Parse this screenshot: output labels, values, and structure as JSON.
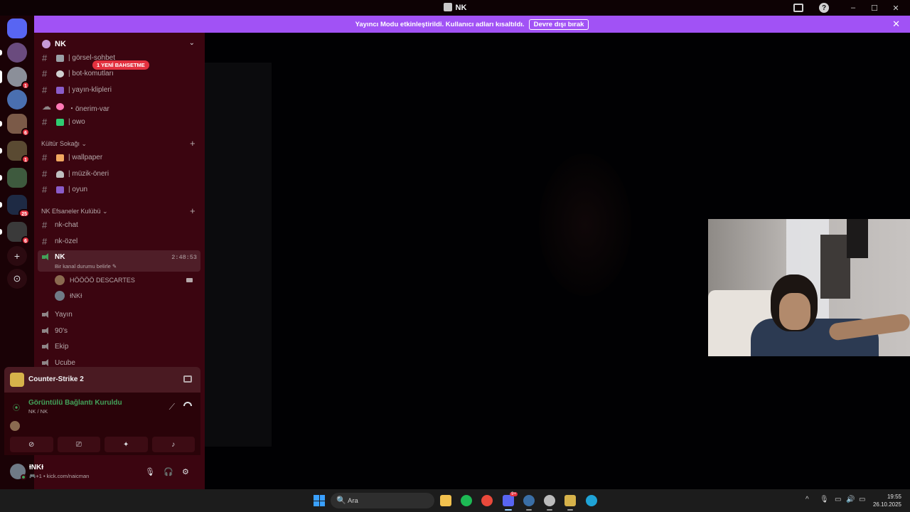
{
  "window": {
    "title": "NK",
    "minimize": "–",
    "maximize": "☐",
    "close": "✕",
    "help": "?"
  },
  "banner": {
    "message": "Yayıncı Modu etkinleştirildi. Kullanıcı adları kısaltıldı.",
    "button_label": "Devre dışı bırak",
    "close": "✕",
    "color": "#a152f5"
  },
  "guilds": [
    {
      "badge": ""
    },
    {
      "badge": ""
    },
    {
      "badge": "1"
    },
    {
      "badge": ""
    },
    {
      "badge": "6"
    },
    {
      "badge": "1"
    },
    {
      "badge": ""
    },
    {
      "badge": "25"
    },
    {
      "badge": "6"
    }
  ],
  "guild_actions": {
    "add": "+",
    "explore": "⊙"
  },
  "server": {
    "name": "NK",
    "chevron": "⌄"
  },
  "mention_pill": "1 YENİ BAHSETME",
  "channels_top": [
    {
      "label": "| görsel-sohbet",
      "emoji_color": "#9aa0a6"
    },
    {
      "label": "| bot-komutları",
      "emoji_color": "#d0d0d0"
    },
    {
      "label": "| yayın-klipleri",
      "emoji_color": "#8a5cc9"
    },
    {
      "label": "・önerim-var",
      "emoji_color": "#ff78b5"
    },
    {
      "label": "| owo",
      "emoji_color": "#2ecc71"
    }
  ],
  "category_kultur": {
    "label": "Kültür Sokağı ⌄",
    "plus": "+"
  },
  "channels_kultur": [
    {
      "label": "| wallpaper",
      "emoji_color": "#f0a860"
    },
    {
      "label": "| müzik-öneri",
      "emoji_color": "#c0c0c0"
    },
    {
      "label": "| oyun",
      "emoji_color": "#8a5cc9"
    }
  ],
  "category_nk": {
    "label": "NK Efsaneler Kulübü ⌄",
    "plus": "+"
  },
  "channels_nk": [
    {
      "label": "nk-chat"
    },
    {
      "label": "nk-özel"
    }
  ],
  "voice_active": {
    "label": "NK",
    "status": "Bir kanal durumu belirle ✎",
    "timer": "2:48:53"
  },
  "voice_users": [
    {
      "name": "HÖÖÖÖ DESCARTES"
    },
    {
      "name": "ƗNKƗ"
    }
  ],
  "voice_channels": [
    {
      "label": "Yayın"
    },
    {
      "label": "90's"
    },
    {
      "label": "Ekip"
    },
    {
      "label": "Ucube"
    }
  ],
  "game": {
    "name": "Counter-Strike 2"
  },
  "voice_panel": {
    "status": "Görüntülü Bağlantı Kuruldu",
    "channel": "NK / NK",
    "signal": "⦿",
    "noise": "⟋",
    "buttons": [
      "⊘",
      "⎚",
      "✦",
      "♪"
    ]
  },
  "user": {
    "name": "ƗNKƗ",
    "status": "🎮+1 • kick.com/naicman",
    "mic": "🎙",
    "headset": "🎧",
    "settings": "⚙"
  },
  "taskbar": {
    "search_placeholder": "Ara",
    "search_icon": "🔍",
    "discord_badge": "9+",
    "apps": [
      {
        "name": "file-explorer-icon",
        "color": "#f2c14e"
      },
      {
        "name": "spotify-icon",
        "color": "#1db954"
      },
      {
        "name": "chrome-icon",
        "color": "#e9493b"
      },
      {
        "name": "discord-icon",
        "color": "#5865f2"
      },
      {
        "name": "steam-icon",
        "color": "#3a6ea5"
      },
      {
        "name": "app-icon",
        "color": "#bbbbbb"
      },
      {
        "name": "counter-strike-icon",
        "color": "#d6b24a"
      },
      {
        "name": "edge-icon",
        "color": "#1fa3d6"
      }
    ],
    "tray": {
      "chevron": "^",
      "mic": "🎙",
      "monitor": "▭",
      "volume": "🔊",
      "battery": "▭"
    },
    "time": "19:55",
    "date": "26.10.2025"
  }
}
